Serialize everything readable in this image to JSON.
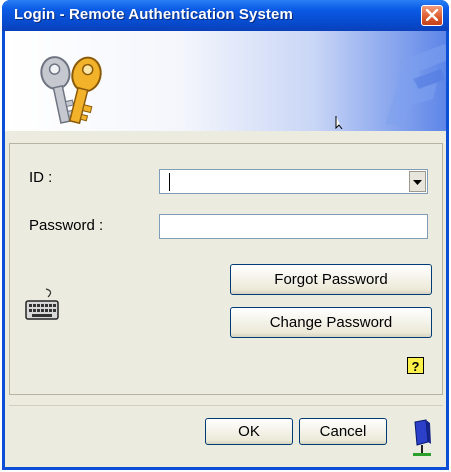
{
  "window": {
    "title": "Login - Remote Authentication System"
  },
  "form": {
    "id_label": "ID :",
    "id_value": "",
    "password_label": "Password :",
    "password_value": ""
  },
  "buttons": {
    "forgot_password": "Forgot Password",
    "change_password": "Change Password",
    "ok": "OK",
    "cancel": "Cancel"
  },
  "icons": {
    "help": "?"
  },
  "colors": {
    "titlebar": "#0748c9",
    "client_bg": "#ecebe0",
    "help_bg": "#fcf04a"
  }
}
